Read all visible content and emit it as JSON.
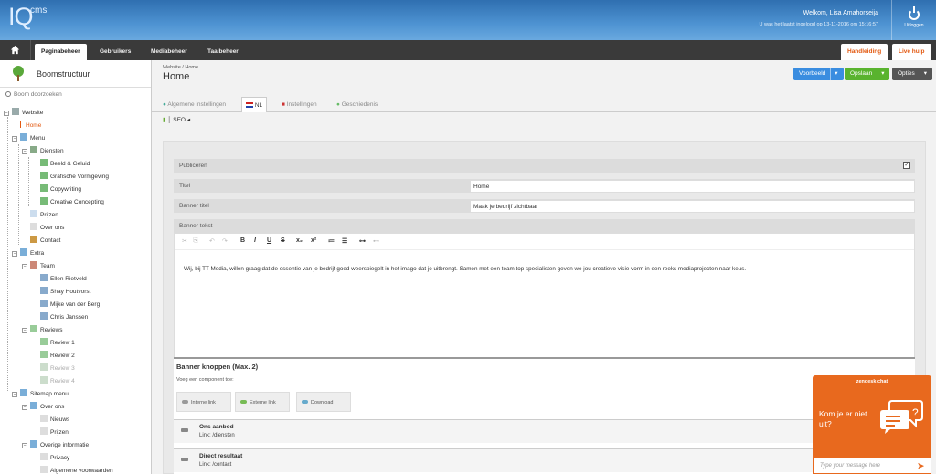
{
  "header": {
    "logo": "IQ",
    "logo_sup": "cms",
    "welcome": "Welkom, Lisa Amahorseija",
    "last_login": "U was het laatst ingelogd op 13-11-2016 om 15:16:57",
    "logout_label": "Uitloggen"
  },
  "nav": {
    "tabs": [
      "Paginabeheer",
      "Gebruikers",
      "Mediabeheer",
      "Taalbeheer"
    ],
    "manual": "Handleiding",
    "live_help": "Live hulp"
  },
  "sidebar": {
    "title": "Boomstructuur",
    "search_placeholder": "Boom doorzoeken",
    "nodes": [
      "Website",
      "Home",
      "Menu",
      "Diensten",
      "Beeld & Geluid",
      "Grafische Vormgeving",
      "Copywriting",
      "Creative Concepting",
      "Prijzen",
      "Over ons",
      "Contact",
      "Extra",
      "Team",
      "Ellen Rietveld",
      "Shay Houtvorst",
      "Mijke van der Berg",
      "Chris Janssen",
      "Reviews",
      "Review 1",
      "Review 2",
      "Review 3",
      "Review 4",
      "Sitemap menu",
      "Over ons",
      "Nieuws",
      "Prijzen",
      "Overige informatie",
      "Privacy",
      "Algemene voorwaarden"
    ]
  },
  "main": {
    "breadcrumb": "Website / Home",
    "title": "Home",
    "preview_btn": "Voorbeeld",
    "save_btn": "Opslaan",
    "options_btn": "Opties",
    "tabs": [
      "Algemene instellingen",
      "NL",
      "Instellingen",
      "Geschiedenis"
    ],
    "seo": "SEO",
    "fields": {
      "publish": "Publiceren",
      "title_label": "Titel",
      "title_value": "Home",
      "banner_title_label": "Banner titel",
      "banner_title_value": "Maak je bedrijf zichtbaar",
      "banner_text_label": "Banner tekst"
    },
    "editor_text": "Wij, bij TT Media, willen graag dat de essentie van je bedrijf goed weerspiegelt in het imago dat je uitbrengt. Samen met een team top specialisten geven we jou creatieve visie vorm in een reeks mediaprojecten naar keus.",
    "buttons_block": {
      "title": "Banner knoppen (Max. 2)",
      "subtitle": "Voeg een component toe:",
      "add": [
        "Interne link",
        "Externe link",
        "Download"
      ],
      "items": [
        {
          "title": "Ons aanbod",
          "link": "Link: /diensten"
        },
        {
          "title": "Direct resultaat",
          "link": "Link: /contact"
        }
      ]
    }
  },
  "chat": {
    "brand": "zendesk chat",
    "question": "Kom je er niet uit?",
    "input_placeholder": "Type your message here"
  },
  "colors": {
    "header": "#4e93d2",
    "accent": "#e35a12",
    "chat": "#e8691e",
    "blue_btn": "#3a8de0",
    "green_btn": "#59b32e"
  }
}
